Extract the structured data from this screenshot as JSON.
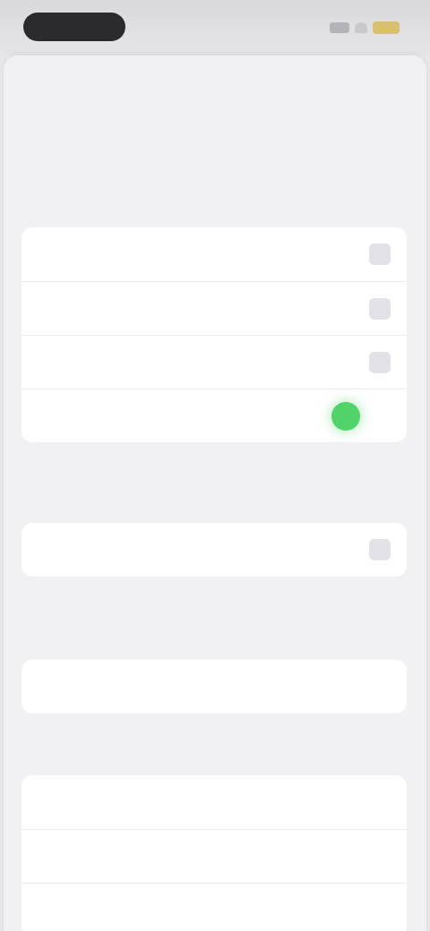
{
  "status_bar": {
    "time": "",
    "battery_color": "#d7c070"
  },
  "nav": {
    "back_label": "",
    "done_label": ""
  },
  "page": {
    "title": "",
    "subtitle": ""
  },
  "group_one": {
    "rows": [
      {
        "label": "",
        "control": "checkbox"
      },
      {
        "label": "",
        "control": "checkbox"
      },
      {
        "label": "",
        "control": "checkbox"
      },
      {
        "label": "",
        "control": "toggle",
        "on": true
      }
    ],
    "footnote": ""
  },
  "group_two": {
    "rows": [
      {
        "label": "",
        "control": "checkbox"
      }
    ],
    "footnote": ""
  },
  "group_three": {
    "rows": [
      {
        "label": ""
      }
    ]
  },
  "section_four": {
    "header": "",
    "rows": [
      {
        "label": ""
      },
      {
        "label": ""
      },
      {
        "label": ""
      }
    ]
  },
  "colors": {
    "accent_green": "#52d36a",
    "background": "#f1f1f4"
  }
}
